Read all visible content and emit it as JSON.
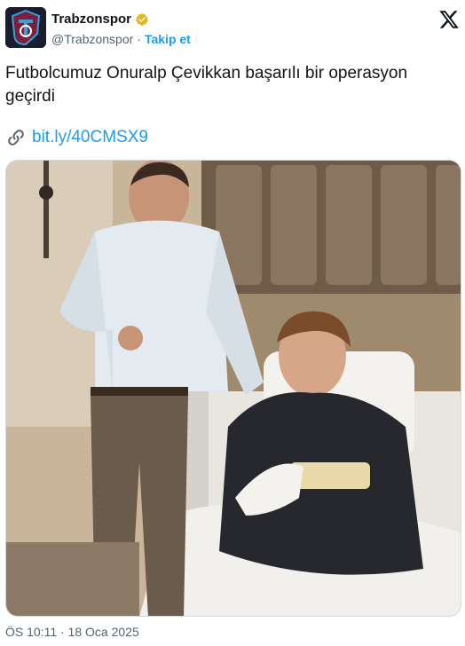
{
  "account": {
    "name": "Trabzonspor",
    "handle": "@Trabzonspor",
    "separator": "·",
    "follow_label": "Takip et"
  },
  "tweet": {
    "text": "Futbolcumuz Onuralp Çevikkan başarılı bir operasyon geçirdi",
    "link": "bit.ly/40CMSX9",
    "timestamp": "ÖS 10:11 · 18 Oca 2025"
  },
  "colors": {
    "link": "#1d9bf0",
    "verified": "#e2b719",
    "text": "#0f1419",
    "muted": "#536471"
  },
  "icons": {
    "verified": "verified-badge-icon",
    "x_logo": "x-logo-icon",
    "link": "link-icon"
  }
}
